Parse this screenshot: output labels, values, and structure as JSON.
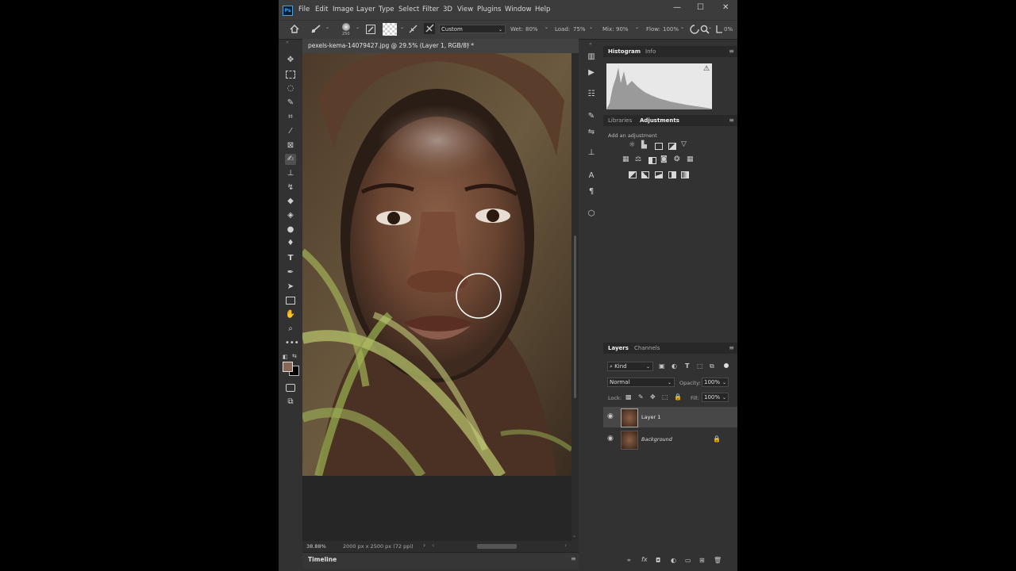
{
  "menu": [
    "File",
    "Edit",
    "Image",
    "Layer",
    "Type",
    "Select",
    "Filter",
    "3D",
    "View",
    "Plugins",
    "Window",
    "Help"
  ],
  "window_controls": {
    "minimize": "—",
    "maximize": "☐",
    "close": "✕"
  },
  "options": {
    "brush_size": "250",
    "preset": "Custom",
    "wet_label": "Wet:",
    "wet_value": "80%",
    "load_label": "Load:",
    "load_value": "75%",
    "mix_label": "Mix:",
    "mix_value": "90%",
    "flow_label": "Flow:",
    "flow_value": "100%",
    "angle_value": "0%"
  },
  "document": {
    "tab_title": "pexels-kema-14079427.jpg @ 29.5% (Layer 1, RGB/8) *",
    "close": "✕"
  },
  "status": {
    "zoom": "38.88%",
    "size": "2000 px x 2500 px (72 ppi)"
  },
  "timeline": {
    "label": "Timeline"
  },
  "histogram": {
    "tabs": [
      "Histogram",
      "Info"
    ],
    "warning": "⚠"
  },
  "adjustments": {
    "tabs": [
      "Libraries",
      "Adjustments"
    ],
    "hint": "Add an adjustment"
  },
  "layers": {
    "tabs": [
      "Layers",
      "Channels"
    ],
    "filter_label": "Kind",
    "blend_mode": "Normal",
    "opacity_label": "Opacity:",
    "opacity_value": "100%",
    "lock_label": "Lock:",
    "fill_label": "Fill:",
    "fill_value": "100%",
    "items": [
      {
        "name": "Layer 1"
      },
      {
        "name": "Background"
      }
    ]
  },
  "colors": {
    "foreground": "#8a6658",
    "background": "#000000",
    "accent": "#4a8fd6"
  }
}
